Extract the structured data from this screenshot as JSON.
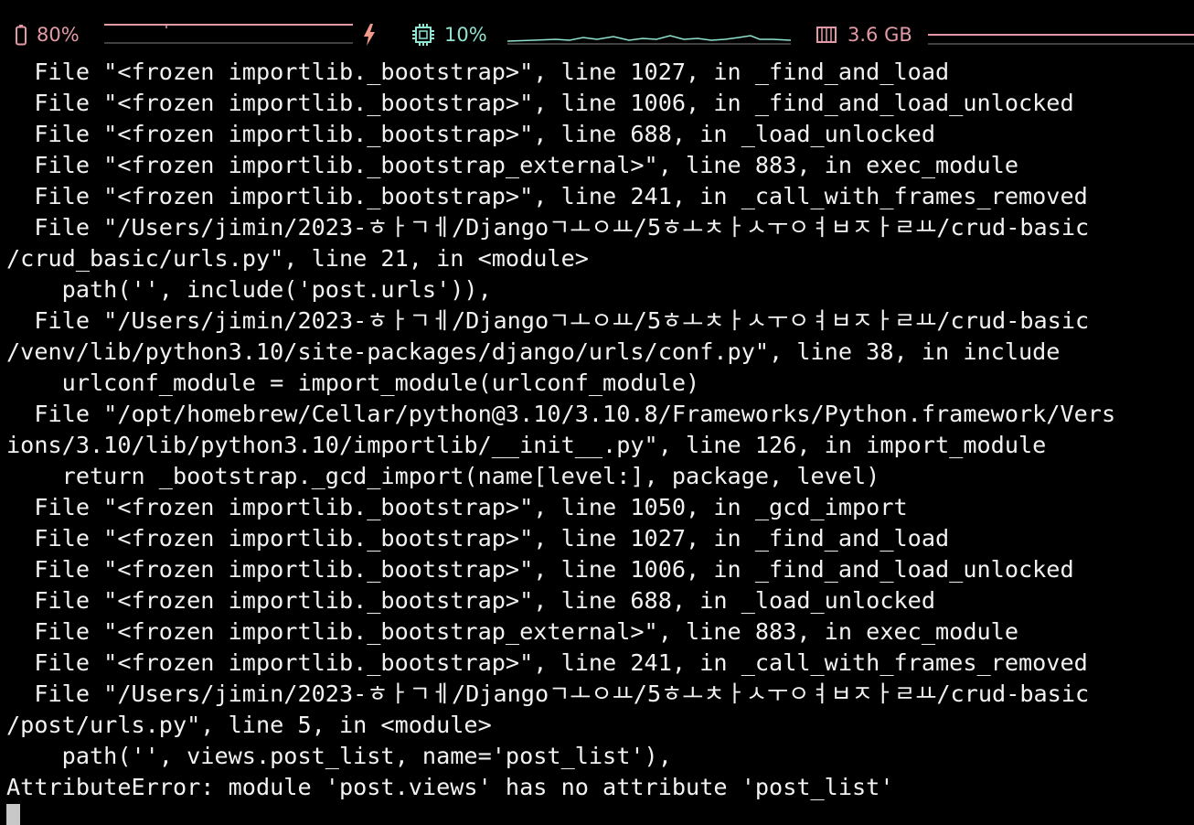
{
  "status_bar": {
    "battery": {
      "icon": "battery-icon",
      "percent_label": "80%",
      "level": 0.8,
      "color": "#e39aa6"
    },
    "charging": {
      "icon": "lightning-bolt-icon",
      "color": "#f09a8a"
    },
    "cpu": {
      "icon": "cpu-chip-icon",
      "percent_label": "10%",
      "color": "#8fe3cf"
    },
    "memory": {
      "icon": "memory-module-icon",
      "usage_label": "3.6 GB",
      "color": "#e39aa6"
    }
  },
  "terminal": {
    "lines": [
      "  File \"<frozen importlib._bootstrap>\", line 1027, in _find_and_load",
      "  File \"<frozen importlib._bootstrap>\", line 1006, in _find_and_load_unlocked",
      "  File \"<frozen importlib._bootstrap>\", line 688, in _load_unlocked",
      "  File \"<frozen importlib._bootstrap_external>\", line 883, in exec_module",
      "  File \"<frozen importlib._bootstrap>\", line 241, in _call_with_frames_removed",
      "  File \"/Users/jimin/2023-ㅎㅏㄱㅔ/Djangoㄱㅗㅇㅛ/5ㅎㅗㅊㅏㅅㅜㅇㅕㅂㅈㅏㄹㅛ/crud-basic",
      "/crud_basic/urls.py\", line 21, in <module>",
      "    path('', include('post.urls')),",
      "  File \"/Users/jimin/2023-ㅎㅏㄱㅔ/Djangoㄱㅗㅇㅛ/5ㅎㅗㅊㅏㅅㅜㅇㅕㅂㅈㅏㄹㅛ/crud-basic",
      "/venv/lib/python3.10/site-packages/django/urls/conf.py\", line 38, in include",
      "    urlconf_module = import_module(urlconf_module)",
      "  File \"/opt/homebrew/Cellar/python@3.10/3.10.8/Frameworks/Python.framework/Vers",
      "ions/3.10/lib/python3.10/importlib/__init__.py\", line 126, in import_module",
      "    return _bootstrap._gcd_import(name[level:], package, level)",
      "  File \"<frozen importlib._bootstrap>\", line 1050, in _gcd_import",
      "  File \"<frozen importlib._bootstrap>\", line 1027, in _find_and_load",
      "  File \"<frozen importlib._bootstrap>\", line 1006, in _find_and_load_unlocked",
      "  File \"<frozen importlib._bootstrap>\", line 688, in _load_unlocked",
      "  File \"<frozen importlib._bootstrap_external>\", line 883, in exec_module",
      "  File \"<frozen importlib._bootstrap>\", line 241, in _call_with_frames_removed",
      "  File \"/Users/jimin/2023-ㅎㅏㄱㅔ/Djangoㄱㅗㅇㅛ/5ㅎㅗㅊㅏㅅㅜㅇㅕㅂㅈㅏㄹㅛ/crud-basic",
      "/post/urls.py\", line 5, in <module>",
      "    path('', views.post_list, name='post_list'),",
      "AttributeError: module 'post.views' has no attribute 'post_list'"
    ]
  }
}
